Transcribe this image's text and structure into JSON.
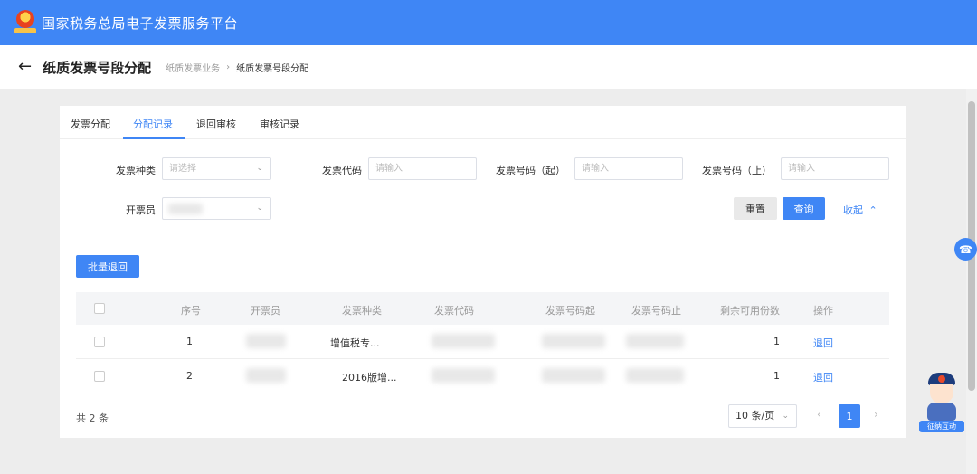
{
  "header": {
    "platform_title": "国家税务总局电子发票服务平台",
    "emblem_icon": "tax-emblem-icon"
  },
  "subheader": {
    "page_title": "纸质发票号段分配",
    "breadcrumb": [
      "纸质发票业务",
      "纸质发票号段分配"
    ]
  },
  "tabs": [
    {
      "label": "发票分配",
      "active": false
    },
    {
      "label": "分配记录",
      "active": true
    },
    {
      "label": "退回审核",
      "active": false
    },
    {
      "label": "审核记录",
      "active": false
    }
  ],
  "filters": {
    "invoice_type": {
      "label": "发票种类",
      "placeholder": "请选择"
    },
    "invoice_code": {
      "label": "发票代码",
      "placeholder": "请输入"
    },
    "number_start": {
      "label": "发票号码（起）",
      "placeholder": "请输入"
    },
    "number_end": {
      "label": "发票号码（止）",
      "placeholder": "请输入"
    },
    "issuer": {
      "label": "开票员"
    },
    "reset_label": "重置",
    "query_label": "查询",
    "collapse_label": "收起"
  },
  "actions": {
    "batch_return_label": "批量退回"
  },
  "table": {
    "columns": [
      "序号",
      "开票员",
      "发票种类",
      "发票代码",
      "发票号码起",
      "发票号码止",
      "剩余可用份数",
      "操作"
    ],
    "rows": [
      {
        "index": "1",
        "invoice_type": "增值税专...",
        "remaining": "1",
        "action": "退回"
      },
      {
        "index": "2",
        "invoice_type": "2016版增...",
        "remaining": "1",
        "action": "退回"
      }
    ]
  },
  "pagination": {
    "total_text": "共 2 条",
    "page_size": "10 条/页",
    "current_page": "1"
  },
  "assistant": {
    "tag_label": "征纳互动"
  },
  "colors": {
    "primary": "#3f86f5",
    "header_bg": "#3f86f5"
  }
}
